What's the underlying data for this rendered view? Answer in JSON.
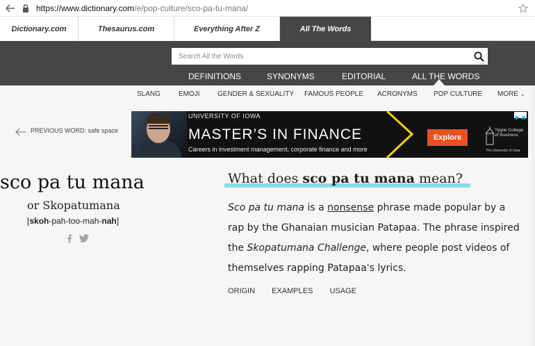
{
  "browser": {
    "url_host": "https://www.dictionary.com",
    "url_path": "/e/pop-culture/sco-pa-tu-mana/"
  },
  "site_tabs": [
    {
      "label": "Dictionary.com"
    },
    {
      "label": "Thesaurus.com"
    },
    {
      "label": "Everything After Z"
    },
    {
      "label": "All The Words"
    }
  ],
  "search": {
    "placeholder": "Search All the Words"
  },
  "main_nav": [
    "DEFINITIONS",
    "SYNONYMS",
    "EDITORIAL",
    "ALL THE WORDS"
  ],
  "sub_nav": [
    "SLANG",
    "EMOJI",
    "GENDER & SEXUALITY",
    "FAMOUS PEOPLE",
    "ACRONYMS",
    "POP CULTURE",
    "MORE"
  ],
  "prev_word": {
    "label": "PREVIOUS WORD: safe space"
  },
  "ad": {
    "university": "UNIVERSITY OF IOWA",
    "headline": "MASTER’S IN FINANCE",
    "subline": "Careers in investment management, corporate finance and more",
    "button": "Explore",
    "logo_text": "Tippie College of Business",
    "logo_sub": "The University of Iowa"
  },
  "entry": {
    "word": "sco pa tu mana",
    "alt_spelling": "or Skopatumana",
    "pron_bracket_open": "[",
    "pron_stress1": "skoh",
    "pron_mid": "-pah-too-mah-",
    "pron_stress2": "nah",
    "pron_bracket_close": "]"
  },
  "question": {
    "prefix": "What does ",
    "term": "sco pa tu mana",
    "suffix": " mean?"
  },
  "definition": {
    "p1": "Sco pa tu mana",
    "p2": " is a ",
    "p3": "nonsense",
    "p4": " phrase made popular by a rap by the Ghanaian musician Patapaa. The phrase inspired the ",
    "p5": "Skopatumana Challenge",
    "p6": ", where people post videos of themselves rapping Patapaa's lyrics."
  },
  "section_tabs": [
    "ORIGIN",
    "EXAMPLES",
    "USAGE"
  ],
  "colors": {
    "nav_dark": "#464646",
    "highlight": "#8ed9ee",
    "ad_button": "#e8501d"
  }
}
